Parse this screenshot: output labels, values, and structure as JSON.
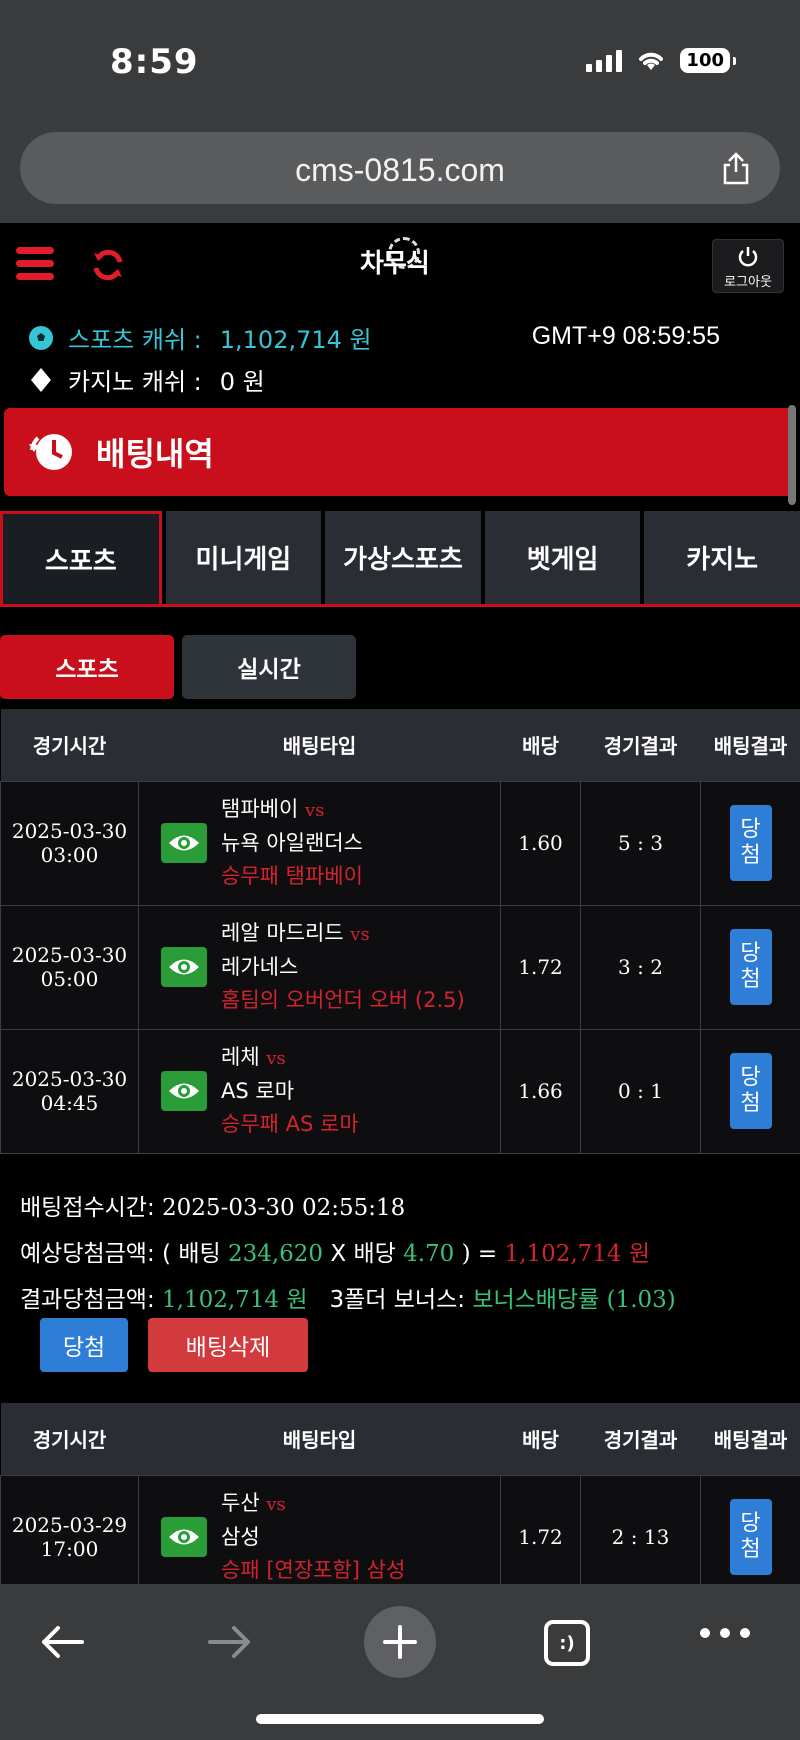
{
  "status_bar": {
    "time": "8:59",
    "battery": "100"
  },
  "browser": {
    "url": "cms-0815.com"
  },
  "header": {
    "logo_text": "차무식",
    "logout_label": "로그아웃"
  },
  "cash": {
    "sports_label": "스포츠 캐쉬 :",
    "sports_value": "1,102,714 원",
    "casino_label": "카지노 캐쉬 :",
    "casino_value": "0 원",
    "clock": "GMT+9 08:59:55"
  },
  "banner": {
    "title": "배팅내역"
  },
  "category_tabs": [
    "스포츠",
    "미니게임",
    "가상스포츠",
    "벳게임",
    "카지노"
  ],
  "sub_tabs": [
    "스포츠",
    "실시간"
  ],
  "table_headers": [
    "경기시간",
    "배팅타입",
    "배당",
    "경기결과",
    "배팅결과"
  ],
  "bet1": {
    "rows": [
      {
        "date": "2025-03-30",
        "time": "03:00",
        "home": "탬파베이",
        "vs": "vs",
        "away": "뉴욕 아일랜더스",
        "pick": "승무패 탬파베이",
        "odds": "1.60",
        "score": "5 : 3",
        "result": "당첨"
      },
      {
        "date": "2025-03-30",
        "time": "05:00",
        "home": "레알 마드리드",
        "vs": "vs",
        "away": "레가네스",
        "pick": "홈팀의 오버언더 오버 (2.5)",
        "odds": "1.72",
        "score": "3 : 2",
        "result": "당첨"
      },
      {
        "date": "2025-03-30",
        "time": "04:45",
        "home": "레체",
        "vs": "vs",
        "away": "AS 로마",
        "pick": "승무패 AS 로마",
        "odds": "1.66",
        "score": "0 : 1",
        "result": "당첨"
      }
    ],
    "summary": {
      "accept_label": "배팅접수시간:",
      "accept_time": "2025-03-30 02:55:18",
      "expected_label": "예상당첨금액:",
      "open_paren": "( 배팅",
      "bet_amount": "234,620",
      "x_label": "X 배당",
      "total_odds": "4.70",
      "close_paren": ") =",
      "expected_amount": "1,102,714 원",
      "result_label": "결과당첨금액:",
      "result_amount": "1,102,714 원",
      "bonus_label": "3폴더 보너스:",
      "bonus_value": "보너스배당률 (1.03)",
      "win_button": "당첨",
      "delete_button": "배팅삭제"
    }
  },
  "bet2": {
    "rows": [
      {
        "date": "2025-03-29",
        "time": "17:00",
        "home": "두산",
        "vs": "vs",
        "away": "삼성",
        "pick": "승패 [연장포함] 삼성",
        "odds": "1.72",
        "score": "2 : 13",
        "result": "당첨"
      }
    ]
  },
  "colors": {
    "accent_red": "#c90f1c",
    "win_blue": "#2e7ed8",
    "amount_green": "#39c07a",
    "sports_cyan": "#35c5d5"
  }
}
